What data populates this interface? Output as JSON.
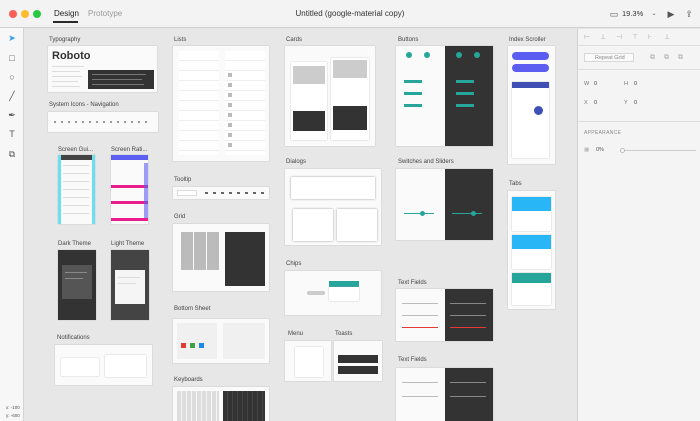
{
  "window": {
    "title": "Untitled (google-material copy)",
    "tabs": [
      "Design",
      "Prototype"
    ],
    "zoom": "19.3%"
  },
  "toolbar": {
    "tools": [
      "select-tool",
      "rectangle-tool",
      "ellipse-tool",
      "line-tool",
      "pen-tool",
      "text-tool",
      "artboard-tool"
    ],
    "x_readout": "x: -100",
    "y_readout": "y: -600"
  },
  "artboards": {
    "typography": "Typography",
    "system_icons": "System Icons - Navigation",
    "screen_guides": "Screen Gui...",
    "screen_ratios": "Screen Rati...",
    "dark_theme": "Dark Theme",
    "light_theme": "Light Theme",
    "notifications": "Notifications",
    "lists": "Lists",
    "tooltip": "Tooltip",
    "grid": "Grid",
    "bottom_sheet": "Bottom Sheet",
    "keyboards": "Keyboards",
    "cards": "Cards",
    "dialogs": "Dialogs",
    "chips": "Chips",
    "menu": "Menu",
    "toasts": "Toasts",
    "buttons": "Buttons",
    "switches_sliders": "Switches and Sliders",
    "text_fields": "Text Fields",
    "text_fields_2": "Text Fields",
    "index_scroller": "Index Scroller",
    "tabs": "Tabs"
  },
  "typography_sample": "Roboto",
  "panel": {
    "repeat_grid": "Repeat Grid",
    "w_label": "W",
    "w_value": "0",
    "h_label": "H",
    "h_value": "0",
    "x_label": "X",
    "x_value": "0",
    "y_label": "Y",
    "y_value": "0",
    "appearance": "APPEARANCE",
    "opacity": "0%"
  },
  "colors": {
    "accent": "#26a69a",
    "selection": "#2c9ef4",
    "purple": "#5b5ef0",
    "pink": "#e91e8c",
    "indigo": "#3f51b5",
    "cyan": "#29b6f6"
  }
}
